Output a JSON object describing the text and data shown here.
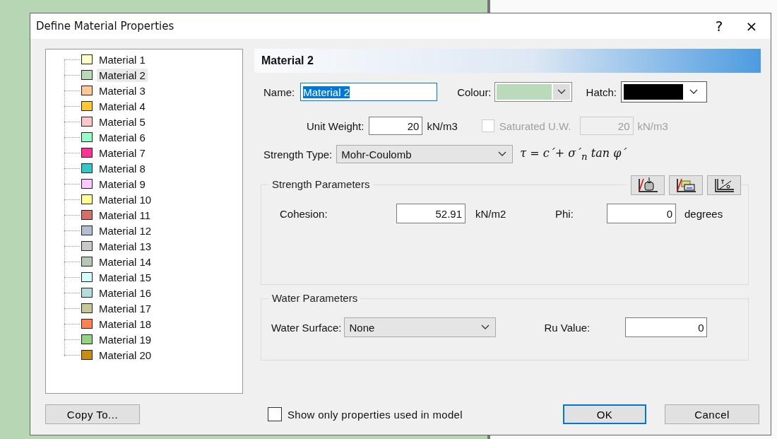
{
  "window": {
    "title": "Define Material Properties",
    "help": "?",
    "close": "×"
  },
  "tree": {
    "items": [
      {
        "label": "Material 1",
        "color": "#ffffc8",
        "selected": false
      },
      {
        "label": "Material 2",
        "color": "#b9dbb9",
        "selected": true
      },
      {
        "label": "Material 3",
        "color": "#ffc896",
        "selected": false
      },
      {
        "label": "Material 4",
        "color": "#ffc832",
        "selected": false
      },
      {
        "label": "Material 5",
        "color": "#ffc8c8",
        "selected": false
      },
      {
        "label": "Material 6",
        "color": "#96ffc8",
        "selected": false
      },
      {
        "label": "Material 7",
        "color": "#ff3296",
        "selected": false
      },
      {
        "label": "Material 8",
        "color": "#32c8c8",
        "selected": false
      },
      {
        "label": "Material 9",
        "color": "#ffc8ff",
        "selected": false
      },
      {
        "label": "Material 10",
        "color": "#ffff96",
        "selected": false
      },
      {
        "label": "Material 11",
        "color": "#d2706a",
        "selected": false
      },
      {
        "label": "Material 12",
        "color": "#b4bed2",
        "selected": false
      },
      {
        "label": "Material 13",
        "color": "#c8c8c8",
        "selected": false
      },
      {
        "label": "Material 14",
        "color": "#b4c8b4",
        "selected": false
      },
      {
        "label": "Material 15",
        "color": "#d2ffff",
        "selected": false
      },
      {
        "label": "Material 16",
        "color": "#b4dcdc",
        "selected": false
      },
      {
        "label": "Material 17",
        "color": "#c8c896",
        "selected": false
      },
      {
        "label": "Material 18",
        "color": "#ff8250",
        "selected": false
      },
      {
        "label": "Material 19",
        "color": "#96d282",
        "selected": false
      },
      {
        "label": "Material 20",
        "color": "#c88c14",
        "selected": false
      }
    ]
  },
  "header": "Material 2",
  "name": {
    "label": "Name:",
    "value": "Material 2",
    "highlighted": true
  },
  "colour": {
    "label": "Colour:",
    "color": "#b9dbb9"
  },
  "hatch": {
    "label": "Hatch:",
    "color": "#000000"
  },
  "unit_weight": {
    "label": "Unit Weight:",
    "value": "20",
    "unit": "kN/m3"
  },
  "saturated": {
    "label": "Saturated U.W.",
    "checked": false,
    "disabled": true,
    "value": "20",
    "unit": "kN/m3"
  },
  "strength_type": {
    "label": "Strength Type:",
    "value": "Mohr-Coulomb",
    "formula": "τ = c´+ σ´$_{n}$ tan φ´"
  },
  "strength_parameters": {
    "title": "Strength Parameters",
    "cohesion": {
      "label": "Cohesion:",
      "value": "52.91",
      "unit": "kN/m2"
    },
    "phi": {
      "label": "Phi:",
      "value": "0",
      "unit": "degrees"
    }
  },
  "water_parameters": {
    "title": "Water Parameters",
    "surface": {
      "label": "Water Surface:",
      "value": "None"
    },
    "ru": {
      "label": "Ru Value:",
      "value": "0"
    }
  },
  "copy_button": "Copy To...",
  "show_only": {
    "label": "Show only properties used in model",
    "checked": false
  },
  "ok_button": "OK",
  "cancel_button": "Cancel"
}
